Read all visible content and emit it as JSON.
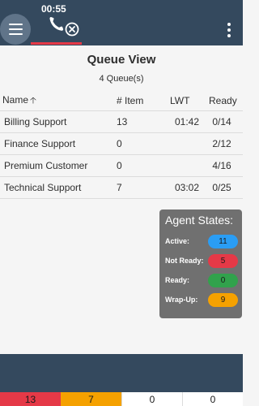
{
  "header": {
    "timer": "00:55",
    "menu_icon": "hamburger-icon",
    "call_icon": "phone-hangup-icon",
    "more_icon": "more-vertical-icon"
  },
  "page": {
    "title": "Queue View",
    "subtitle": "4 Queue(s)"
  },
  "table": {
    "columns": [
      "Name",
      "# Item",
      "LWT",
      "Ready"
    ],
    "sort_icon": "arrow-up-icon",
    "rows": [
      {
        "name": "Billing Support",
        "items": "13",
        "lwt": "01:42",
        "ready": "0/14"
      },
      {
        "name": "Finance Support",
        "items": "0",
        "lwt": "",
        "ready": "2/12"
      },
      {
        "name": "Premium Customer",
        "items": "0",
        "lwt": "",
        "ready": "4/16"
      },
      {
        "name": "Technical Support",
        "items": "7",
        "lwt": "03:02",
        "ready": "0/25"
      }
    ]
  },
  "agent_states": {
    "title": "Agent States:",
    "states": [
      {
        "label": "Active:",
        "value": "11",
        "color": "#2a9df4"
      },
      {
        "label": "Not Ready:",
        "value": "5",
        "color": "#e53947"
      },
      {
        "label": "Ready:",
        "value": "0",
        "color": "#31a24c"
      },
      {
        "label": "Wrap-Up:",
        "value": "9",
        "color": "#f5a100"
      }
    ]
  },
  "footer": {
    "tiles": [
      {
        "value": "13",
        "color": "#e53947"
      },
      {
        "value": "7",
        "color": "#f5a100"
      },
      {
        "value": "0",
        "color": "#ffffff"
      },
      {
        "value": "0",
        "color": "#ffffff"
      }
    ]
  },
  "colors": {
    "bar_background": "#34495e",
    "call_active_underline": "#e53947"
  }
}
